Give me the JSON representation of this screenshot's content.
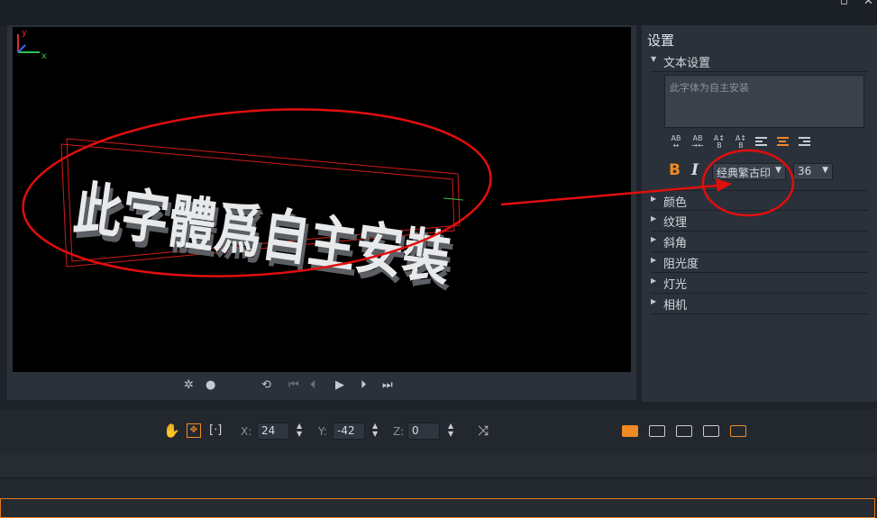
{
  "window": {
    "maximize_icon": "maximize-icon",
    "close_icon": "close-icon",
    "close_glyph": "✕"
  },
  "preview": {
    "axis": {
      "y": "y",
      "x": "x"
    },
    "title_3d_text": "此字體爲自主安裝",
    "annotation_color": "#e10e0e"
  },
  "transport": {
    "buttons": [
      "snapshot-icon",
      "bomb-icon",
      "loop-icon",
      "skip-start-icon",
      "step-back-icon",
      "play-icon",
      "step-forward-icon",
      "skip-end-icon"
    ]
  },
  "settings": {
    "title": "设置",
    "text_section": "文本设置",
    "text_value": "此字体为自主安装",
    "font_name": "经典繁古印",
    "font_size": "36",
    "bold_label": "B",
    "italic_label": "I",
    "sections": [
      "颜色",
      "纹理",
      "斜角",
      "阻光度",
      "灯光",
      "相机"
    ]
  },
  "toolbar": {
    "x_label": "X:",
    "x_value": "24",
    "y_label": "Y:",
    "y_value": "-42",
    "z_label": "Z:",
    "z_value": "0"
  },
  "colors": {
    "accent": "#f08a24",
    "panel": "#2b313a",
    "background": "#1e232a"
  }
}
